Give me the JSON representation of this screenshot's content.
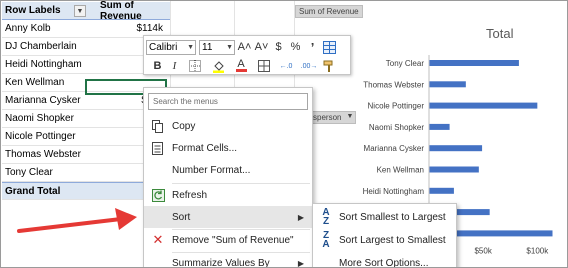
{
  "pivot": {
    "header_label": "Row Labels",
    "header_value": "Sum of Revenue",
    "rows": [
      {
        "label": "Anny Kolb",
        "value": "$114k"
      },
      {
        "label": "DJ Chamberlain",
        "value": ""
      },
      {
        "label": "Heidi Nottingham",
        "value": ""
      },
      {
        "label": "Ken Wellman",
        "value": ""
      },
      {
        "label": "Marianna Cysker",
        "value": "$49k"
      },
      {
        "label": "Naomi Shopker",
        "value": ""
      },
      {
        "label": "Nicole Pottinger",
        "value": "$"
      },
      {
        "label": "Thomas Webster",
        "value": ""
      },
      {
        "label": "Tony Clear",
        "value": ""
      }
    ],
    "total_label": "Grand Total",
    "total_value": "$"
  },
  "chart": {
    "field_button_value": "Sum of Revenue",
    "field_button_axis": "sperson",
    "title": "Total",
    "bar_color": "#4472c4"
  },
  "chart_data": {
    "type": "bar",
    "orientation": "horizontal",
    "title": "Total",
    "categories": [
      "Tony Clear",
      "Thomas Webster",
      "Nicole Pottinger",
      "Naomi Shopker",
      "Marianna Cysker",
      "Ken Wellman",
      "Heidi Nottingham",
      "DJ Chamberlain",
      "Anny Kolb"
    ],
    "values": [
      83,
      34,
      100,
      19,
      49,
      46,
      23,
      56,
      114
    ],
    "x_ticks": [
      "$0k",
      "$50k",
      "$100k"
    ],
    "xlim": [
      0,
      120
    ],
    "units": "$k"
  },
  "mini_toolbar": {
    "font_name": "Calibri",
    "font_size": "11",
    "increase_font_label": "A˄",
    "decrease_font_label": "A˅",
    "currency_label": "$",
    "percent_label": "%",
    "comma_label": "’",
    "bold_label": "B",
    "italic_label": "I",
    "font_color_label": "A",
    "increase_decimal_label": "←.0",
    "decrease_decimal_label": ".00→"
  },
  "context_menu": {
    "search_placeholder": "Search the menus",
    "items": {
      "copy": "Copy",
      "format_cells": "Format Cells...",
      "number_format": "Number Format...",
      "refresh": "Refresh",
      "sort": "Sort",
      "remove": "Remove \"Sum of Revenue\"",
      "summarize": "Summarize Values By"
    }
  },
  "sort_submenu": {
    "items": {
      "smallest_to_largest": "Sort Smallest to Largest",
      "largest_to_smallest": "Sort Largest to Smallest",
      "more_options": "More Sort Options..."
    }
  },
  "colors": {
    "accent_red": "#e53935",
    "pivot_header_bg": "#dde7f3",
    "selection_green": "#217346"
  }
}
